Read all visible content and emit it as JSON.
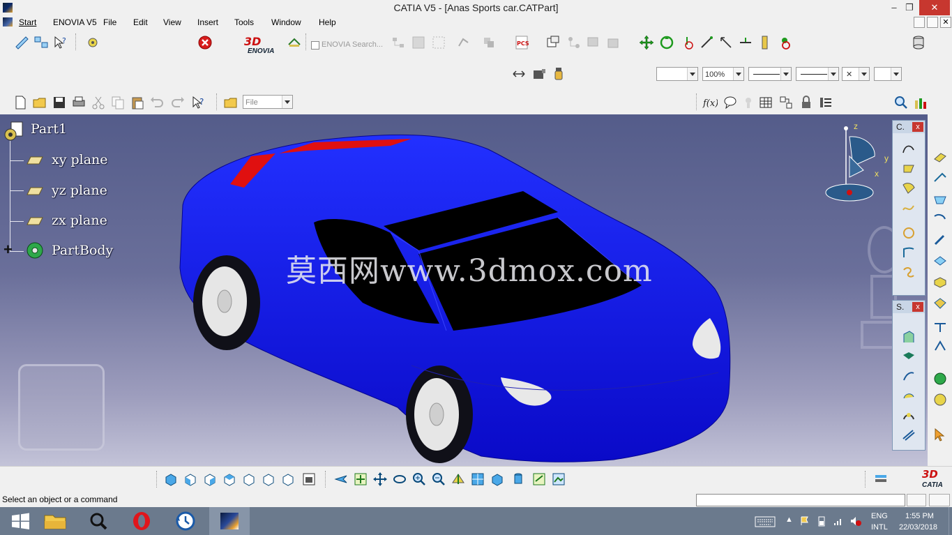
{
  "window": {
    "title": "CATIA V5 - [Anas Sports car.CATPart]",
    "minimize_glyph": "–",
    "maximize_glyph": "❐",
    "close_glyph": "✕"
  },
  "menu": {
    "items": [
      "Start",
      "ENOVIA V5",
      "File",
      "Edit",
      "View",
      "Insert",
      "Tools",
      "Window",
      "Help"
    ]
  },
  "toolbar": {
    "enovia_search_label": "ENOVIA Search...",
    "zoom_value": "100%",
    "file_combo_value": "File",
    "enovia_logo_text": "ENOVIA"
  },
  "tree": {
    "root": "Part1",
    "items": [
      "xy plane",
      "yz plane",
      "zx plane",
      "PartBody"
    ]
  },
  "compass": {
    "axes": [
      "z",
      "y",
      "x"
    ]
  },
  "viewport": {
    "watermark": "莫西网www.3dmox.com",
    "body_color": "#0a10e0",
    "accent_color": "#e01010"
  },
  "floating_toolbars": [
    {
      "title": "C."
    },
    {
      "title": "S."
    }
  ],
  "status": {
    "message": "Select an object or a command"
  },
  "brand": {
    "logo_text": "CATIA"
  },
  "taskbar": {
    "lang": "ENG",
    "layout": "INTL",
    "time": "1:55 PM",
    "date": "22/03/2018"
  }
}
